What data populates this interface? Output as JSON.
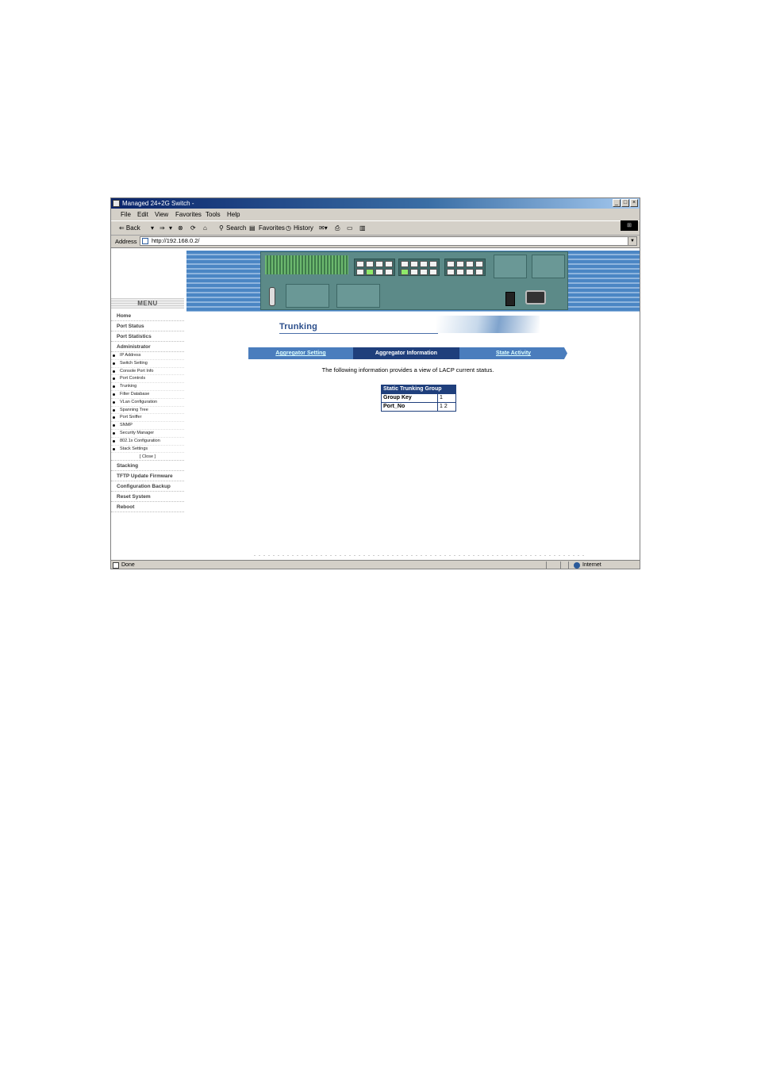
{
  "window": {
    "title": "Managed 24+2G Switch -",
    "controls": [
      "_",
      "□",
      "×"
    ]
  },
  "menubar": {
    "items": [
      "File",
      "Edit",
      "View",
      "Favorites",
      "Tools",
      "Help"
    ]
  },
  "toolbar": {
    "back": "⇐ Back",
    "back_dropdown": "▾",
    "forward": "⇒",
    "forward_dropdown": "▾",
    "search": "Search",
    "favorites": "Favorites",
    "history": "History"
  },
  "address": {
    "label": "Address",
    "url": "http://192.168.0.2/"
  },
  "sidebar": {
    "menu_title": "MENU",
    "top_items": [
      "Home",
      "Port Status",
      "Port Statistics",
      "Administrator"
    ],
    "sub_items": [
      "IP Address",
      "Switch Setting",
      "Console Port Info",
      "Port Controls",
      "Trunking",
      "Filter Database",
      "VLan Configuration",
      "Spanning Tree",
      "Port Sniffer",
      "SNMP",
      "Security Manager",
      "802.1x Configuration",
      "Stack Settings"
    ],
    "close_label": "[ Close ]",
    "bottom_items": [
      "Stacking",
      "TFTP Update Firmware",
      "Configuration Backup",
      "Reset System",
      "Reboot"
    ]
  },
  "main": {
    "page_title": "Trunking",
    "tabs": [
      {
        "label": "Aggregator Setting",
        "active": false
      },
      {
        "label": "Aggregator Information",
        "active": true
      },
      {
        "label": "State Activity",
        "active": false
      }
    ],
    "info_text": "The following information provides a view of LACP current status.",
    "table": {
      "header": "Static Trunking Group",
      "rows": [
        {
          "label": "Group Key",
          "value": "1"
        },
        {
          "label": "Port_No",
          "value": "1 2"
        }
      ]
    }
  },
  "statusbar": {
    "text": "Done",
    "zone": "Internet"
  },
  "colors": {
    "titlebar": "#0a246a",
    "tab_active": "#1f3f7c",
    "tab_inactive": "#4a7dbd",
    "banner": "#4b86c4",
    "device": "#5c8a88"
  }
}
